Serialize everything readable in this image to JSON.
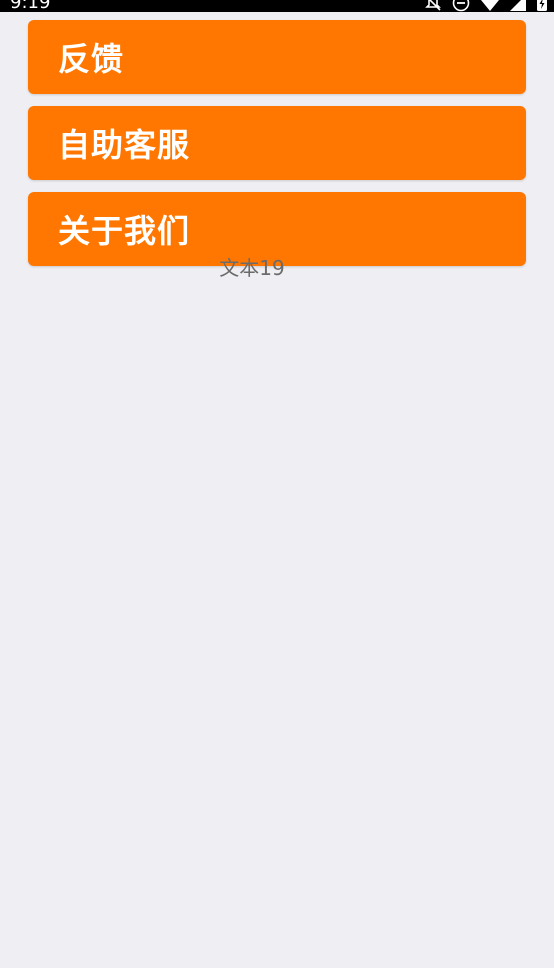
{
  "status_bar": {
    "time": "9:19",
    "icons": [
      "notifications-off-icon",
      "do-not-disturb-icon",
      "wifi-icon",
      "signal-icon",
      "battery-charging-icon"
    ]
  },
  "menu": {
    "items": [
      {
        "label": "反馈"
      },
      {
        "label": "自助客服"
      },
      {
        "label": "关于我们"
      }
    ]
  },
  "caption": "文本19",
  "colors": {
    "accent": "#FF7700",
    "background": "#EFEEF3",
    "status_bar": "#000000",
    "caption_text": "#6b6b6b"
  }
}
